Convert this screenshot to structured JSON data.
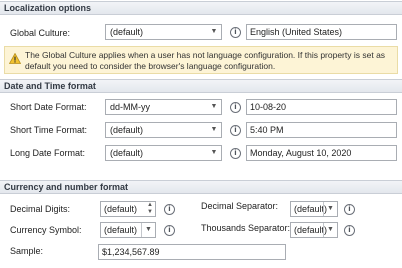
{
  "localization": {
    "header": "Localization options",
    "global_culture_label": "Global Culture:",
    "global_culture_value": "(default)",
    "global_culture_display": "English (United States)",
    "warning_text": "The Global Culture applies when a user has not language configuration. If this property is set as default you need to consider the browser's language configuration."
  },
  "datetime": {
    "header": "Date and Time format",
    "short_date_label": "Short Date Format:",
    "short_date_value": "dd-MM-yy",
    "short_date_preview": "10-08-20",
    "short_time_label": "Short Time Format:",
    "short_time_value": "(default)",
    "short_time_preview": "5:40 PM",
    "long_date_label": "Long Date Format:",
    "long_date_value": "(default)",
    "long_date_preview": "Monday, August 10, 2020"
  },
  "currency": {
    "header": "Currency and number format",
    "decimal_digits_label": "Decimal Digits:",
    "decimal_digits_value": "(default)",
    "currency_symbol_label": "Currency Symbol:",
    "currency_symbol_value": "(default)",
    "decimal_separator_label": "Decimal Separator:",
    "decimal_separator_value": "(default)",
    "thousands_separator_label": "Thousands Separator:",
    "thousands_separator_value": "(default)",
    "sample_label": "Sample:",
    "sample_value": "$1,234,567.89"
  },
  "icons": {
    "info": "info-icon",
    "warning": "warning-icon",
    "dropdown": "chevron-down-icon"
  },
  "colors": {
    "warning_background": "#fdf4d6",
    "warning_triangle": "#f2c230",
    "section_header_background": "#e3e7ed"
  }
}
